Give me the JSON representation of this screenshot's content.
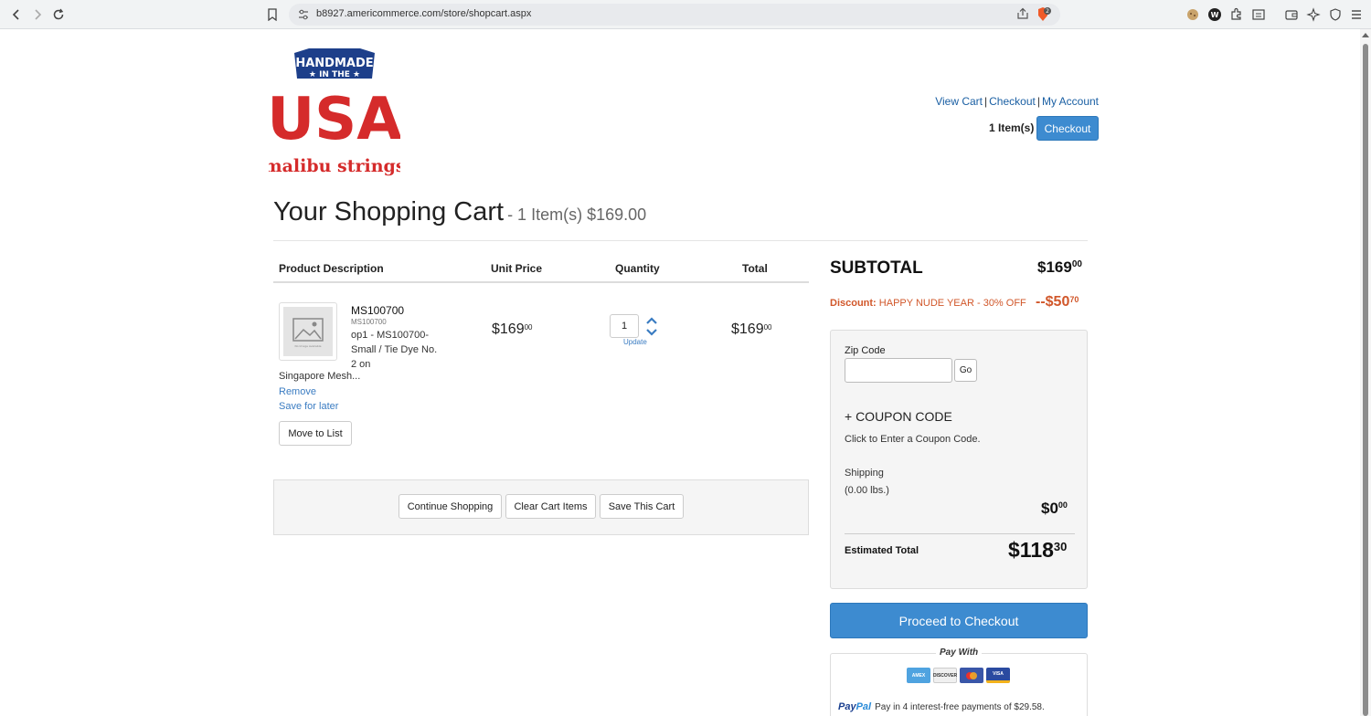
{
  "browser": {
    "url": "b8927.americommerce.com/store/shopcart.aspx",
    "brave_badge": "2"
  },
  "logo": {
    "line1": "HANDMADE",
    "line2": "★ IN THE ★",
    "line3": "USA",
    "line4": "malibu strings"
  },
  "header": {
    "view_cart": "View Cart",
    "checkout_link": "Checkout",
    "my_account": "My Account",
    "items_count": "1 Item(s)",
    "checkout_button": "Checkout"
  },
  "cart": {
    "title": "Your Shopping Cart",
    "subtitle": "- 1 Item(s) $169.00",
    "columns": [
      "Product Description",
      "Unit Price",
      "Quantity",
      "Total"
    ],
    "item": {
      "sku": "MS100700",
      "sku_small": "MS100700",
      "description": "op1 - MS100700-Small / Tie Dye No. 2 on",
      "description_cont": "Singapore Mesh...",
      "remove": "Remove",
      "save_for_later": "Save for later",
      "move_to_list": "Move to List",
      "unit_price_main": "$169",
      "unit_price_cents": "00",
      "quantity": "1",
      "update": "Update",
      "total_main": "$169",
      "total_cents": "00",
      "thumb_text": "No Image Available"
    },
    "buttons": {
      "continue": "Continue Shopping",
      "clear": "Clear Cart Items",
      "save": "Save This Cart"
    }
  },
  "summary": {
    "subtotal_label": "SUBTOTAL",
    "subtotal_main": "$169",
    "subtotal_cents": "00",
    "discount_label": "Discount:",
    "discount_name": "HAPPY NUDE YEAR - 30% OFF",
    "discount_main": "--$50",
    "discount_cents": "70",
    "zip_label": "Zip Code",
    "zip_value": "",
    "go": "Go",
    "coupon_title": "+ COUPON CODE",
    "coupon_sub": "Click to Enter a Coupon Code.",
    "shipping_label": "Shipping",
    "shipping_weight": "(0.00 lbs.)",
    "shipping_main": "$0",
    "shipping_cents": "00",
    "estimated_label": "Estimated Total",
    "estimated_main": "$118",
    "estimated_cents": "30",
    "proceed": "Proceed to Checkout",
    "pay_with": "Pay With",
    "cards": [
      "AMEX",
      "DISCOVER",
      "",
      "VISA"
    ],
    "paypal_a": "Pay",
    "paypal_b": "Pal",
    "paypal_text": "Pay in 4 interest-free payments of $29.58."
  },
  "colors": {
    "accent": "#3d8bd0",
    "link": "#1a5fa3",
    "discount": "#d1572a",
    "logo_red": "#d52b2b",
    "logo_blue": "#1d3f8a"
  }
}
